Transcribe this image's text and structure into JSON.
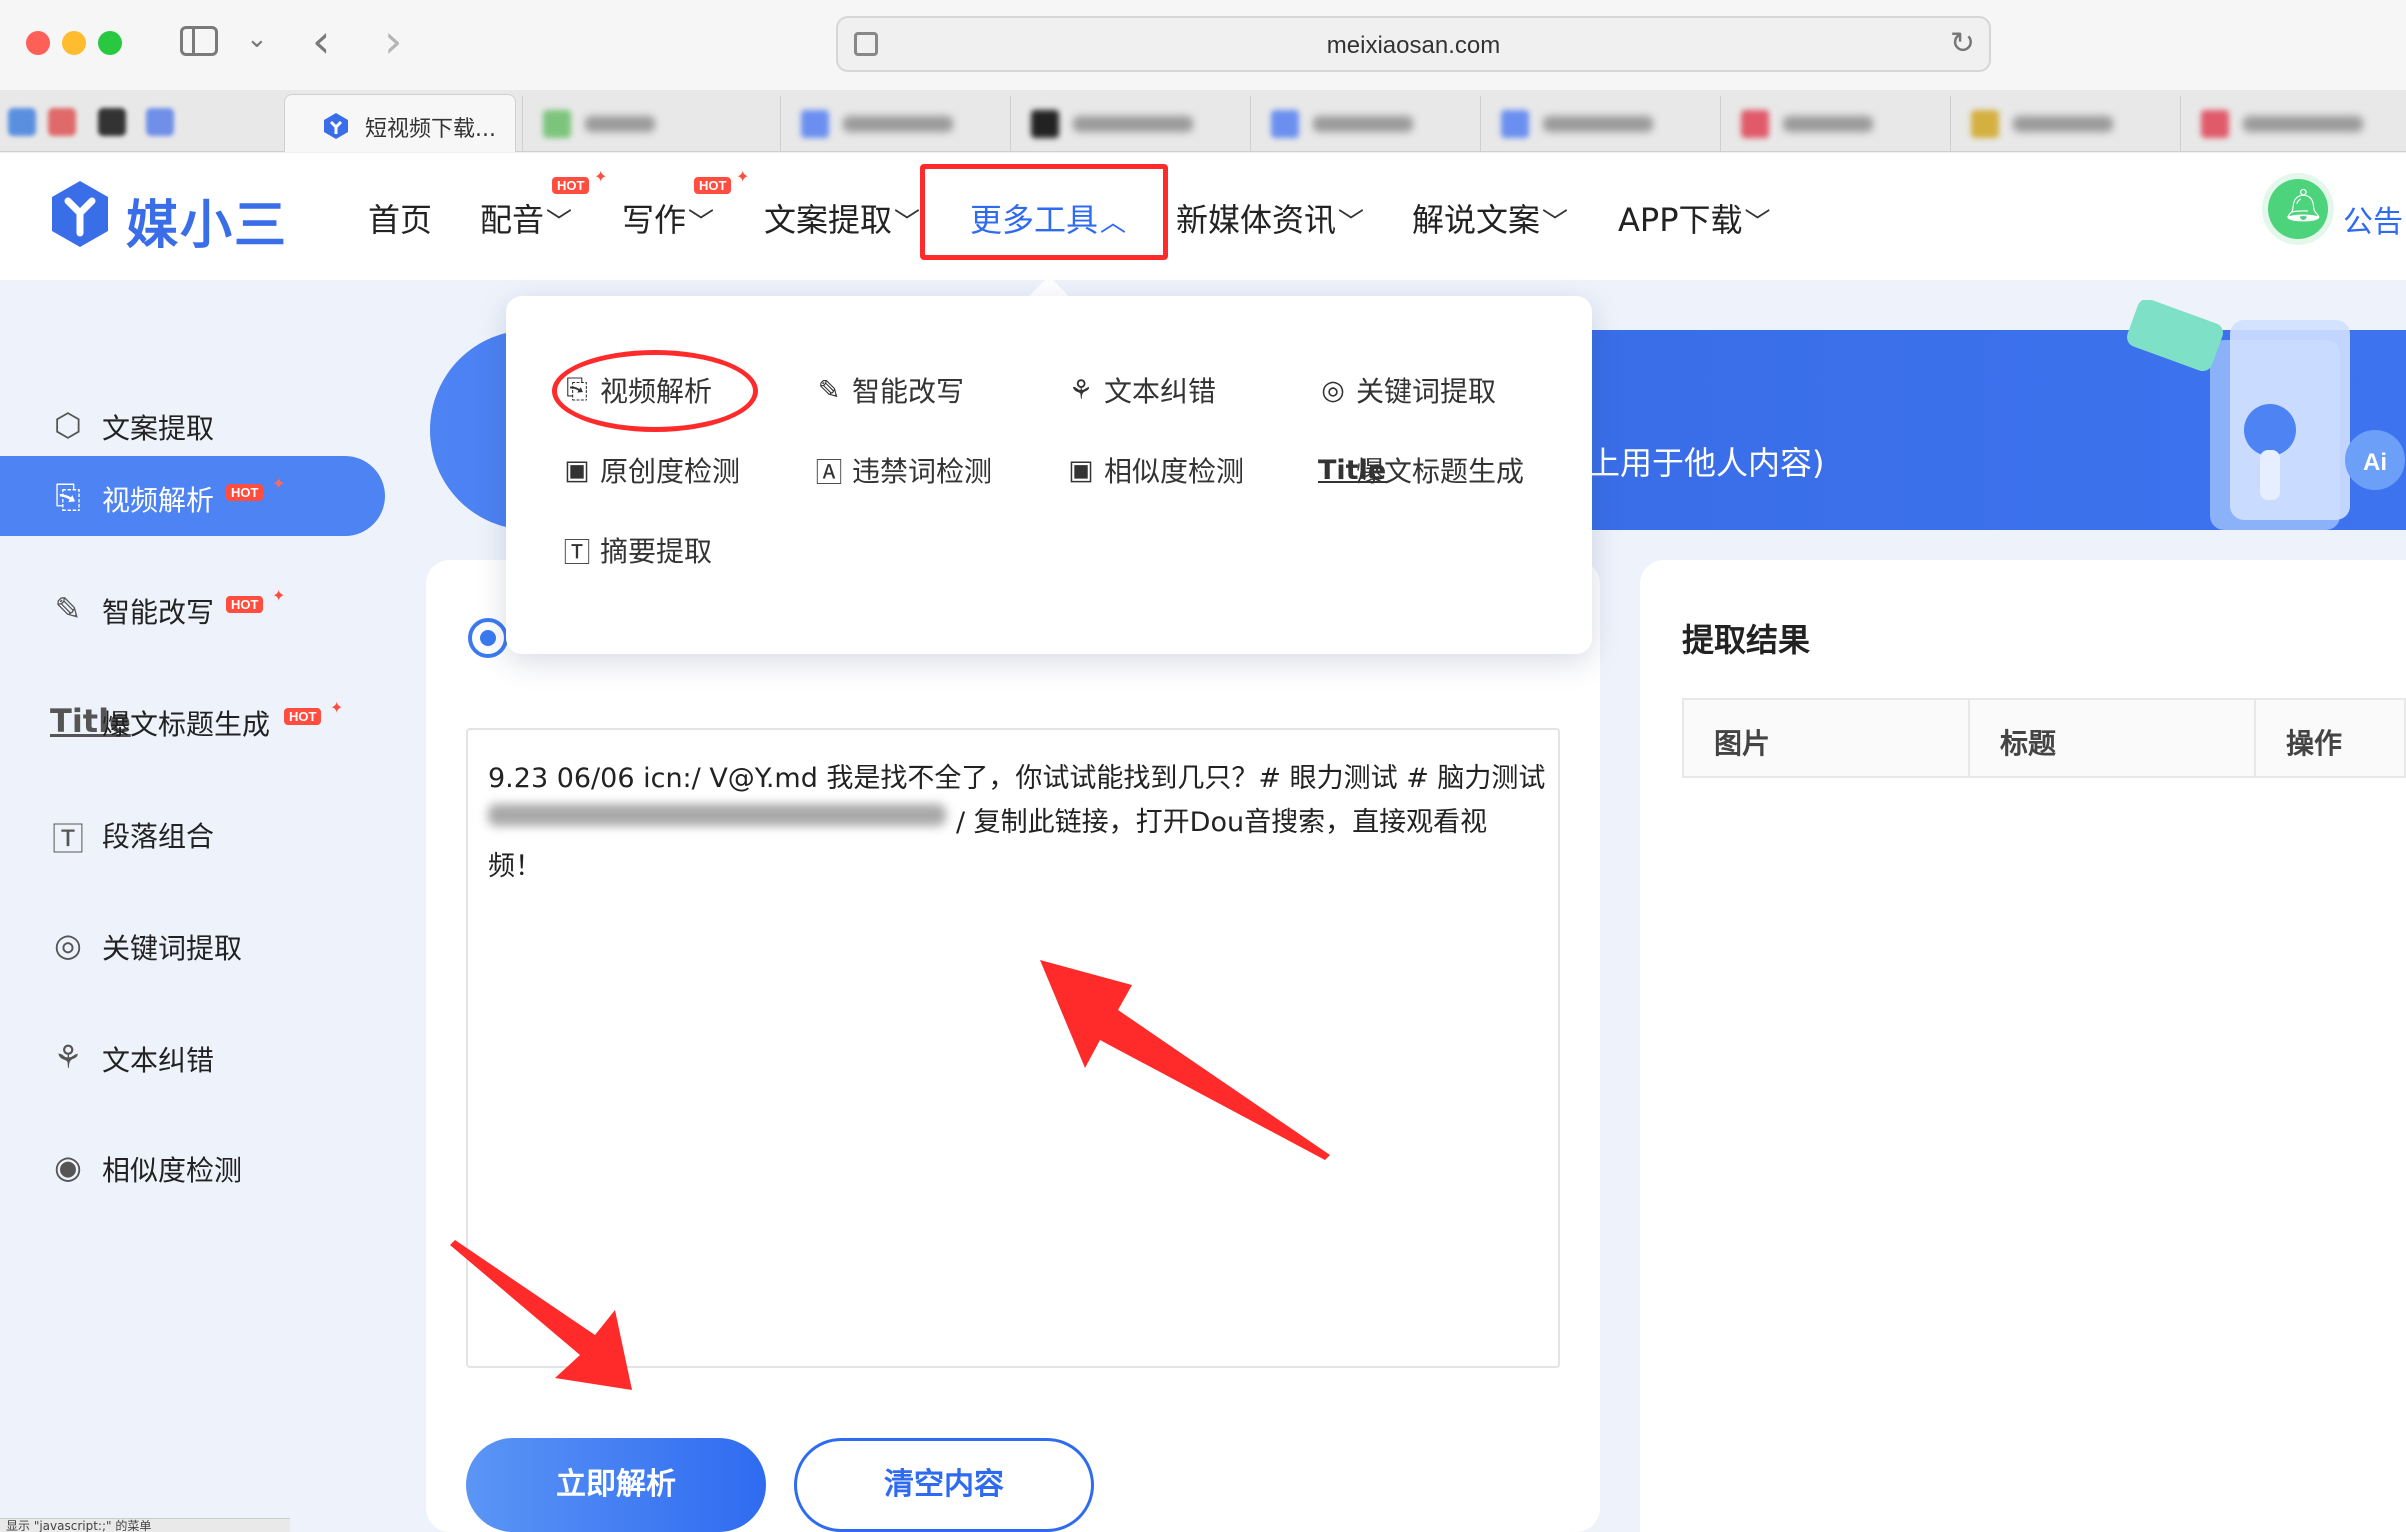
{
  "browser": {
    "url": "meixiaosan.com",
    "active_tab_title": "短视频下载..."
  },
  "header": {
    "logo_text": "媒小三",
    "nav": [
      {
        "label": "首页",
        "has_chevron": false,
        "hot": false
      },
      {
        "label": "配音",
        "has_chevron": true,
        "hot": true
      },
      {
        "label": "写作",
        "has_chevron": true,
        "hot": true
      },
      {
        "label": "文案提取",
        "has_chevron": true,
        "hot": false
      },
      {
        "label": "更多工具",
        "has_chevron": true,
        "hot": false,
        "expanded": true
      },
      {
        "label": "新媒体资讯",
        "has_chevron": true,
        "hot": false
      },
      {
        "label": "解说文案",
        "has_chevron": true,
        "hot": false
      },
      {
        "label": "APP下载",
        "has_chevron": true,
        "hot": false
      }
    ],
    "hot_label": "HOT",
    "announcement": "公告"
  },
  "dropdown": {
    "items": [
      {
        "label": "视频解析",
        "icon": "video-parse-icon"
      },
      {
        "label": "智能改写",
        "icon": "edit-icon"
      },
      {
        "label": "文本纠错",
        "icon": "bug-icon"
      },
      {
        "label": "关键词提取",
        "icon": "target-icon"
      },
      {
        "label": "原创度检测",
        "icon": "ai-doc-icon"
      },
      {
        "label": "违禁词检测",
        "icon": "a-box-icon"
      },
      {
        "label": "相似度检测",
        "icon": "ai-doc-icon"
      },
      {
        "label": "爆文标题生成",
        "icon": "title-icon"
      },
      {
        "label": "摘要提取",
        "icon": "t-box-icon"
      }
    ]
  },
  "sidebar": {
    "items": [
      {
        "label": "文案提取",
        "icon": "cube-icon",
        "hot": false,
        "active": false
      },
      {
        "label": "视频解析",
        "icon": "video-parse-icon",
        "hot": true,
        "active": true
      },
      {
        "label": "智能改写",
        "icon": "edit-icon",
        "hot": true,
        "active": false
      },
      {
        "label": "爆文标题生成",
        "icon": "title-icon",
        "hot": true,
        "active": false
      },
      {
        "label": "段落组合",
        "icon": "t-box-icon",
        "hot": false,
        "active": false
      },
      {
        "label": "关键词提取",
        "icon": "target-icon",
        "hot": false,
        "active": false
      },
      {
        "label": "文本纠错",
        "icon": "bug-icon",
        "hot": false,
        "active": false
      },
      {
        "label": "相似度检测",
        "icon": "search-doc-icon",
        "hot": false,
        "active": false
      }
    ],
    "title_mini": "Title"
  },
  "banner": {
    "text_fragment": "上用于他人内容)"
  },
  "input": {
    "line1": "9.23 06/06 icn:/ V@Y.md 我是找不全了，你试试能找到几只？# 眼力测试 # 脑力测试",
    "line2_tail": "/ 复制此链接，打开Dou音搜索，直接观看视",
    "line3": "频！"
  },
  "buttons": {
    "parse": "立即解析",
    "clear": "清空内容"
  },
  "result": {
    "title": "提取结果",
    "columns": [
      "图片",
      "标题",
      "操作"
    ]
  },
  "status_bar": "显示 \"javascript:;\" 的菜单",
  "colors": {
    "accent": "#2f6bf1",
    "highlight_red": "#ff2a2a",
    "hot_red": "#ff4d3f"
  }
}
